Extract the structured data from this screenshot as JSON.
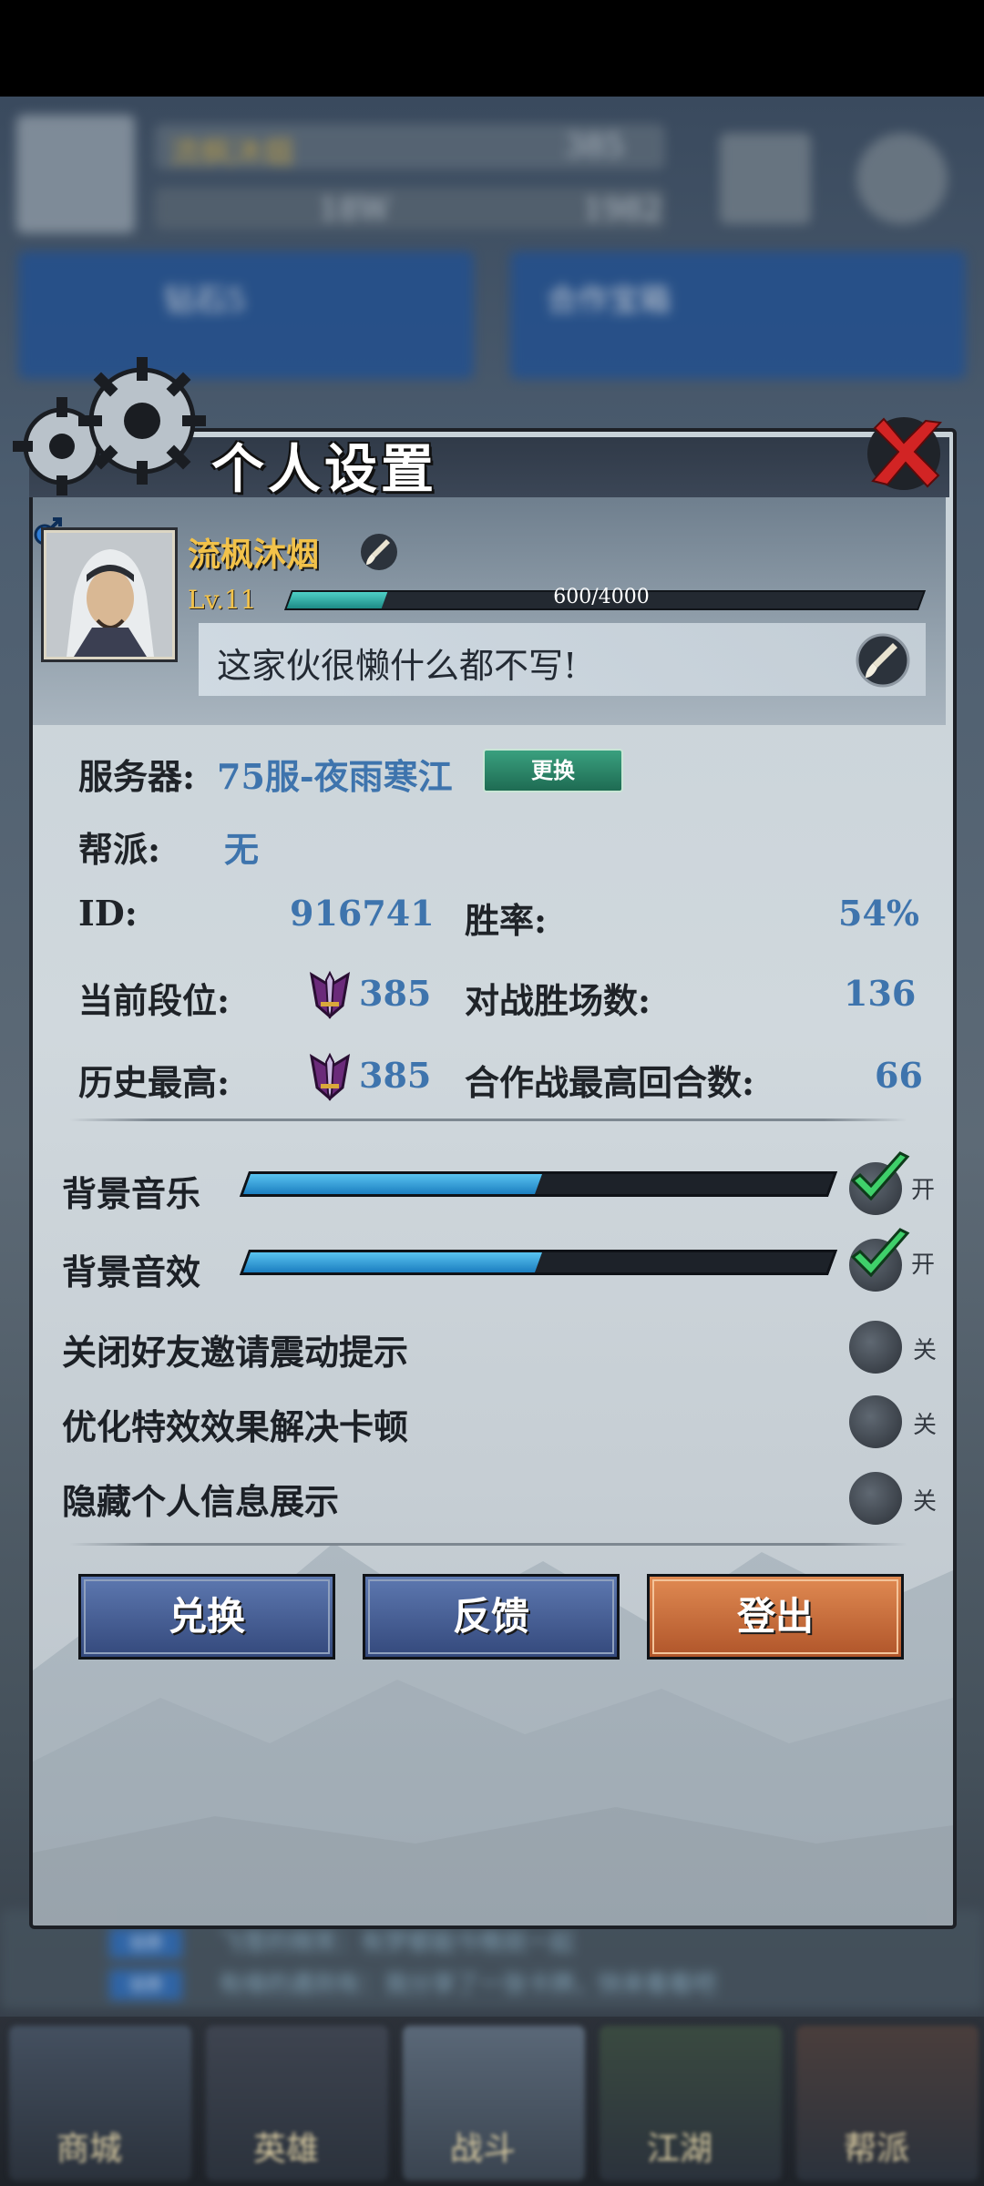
{
  "background": {
    "player_name_blurred": "流枫沐烟",
    "rank_blurred": "385",
    "power_blurred": "18W",
    "gold_blurred": "1982",
    "card1_title": "钻石5",
    "card2_title": "合作宝箱",
    "chat": [
      {
        "tag": "世界",
        "text": "飞雪的微笑：有梦都能今晚就一起"
      },
      {
        "tag": "世界",
        "text": "有缘的遇到有：我分享了一张卡牌，快来看看吧"
      }
    ],
    "nav": [
      "商城",
      "英雄",
      "战斗",
      "江湖",
      "帮派"
    ]
  },
  "dialog": {
    "title": "个人设置",
    "profile": {
      "name": "流枫沐烟",
      "level": "Lv.11",
      "exp_text": "600/4000",
      "exp_fraction": 0.15,
      "signature": "这家伙很懒什么都不写!"
    },
    "info": {
      "server_label": "服务器:",
      "server_value": "75服-夜雨寒江",
      "change_label": "更换",
      "guild_label": "帮派:",
      "guild_value": "无",
      "id_label": "ID:",
      "id_value": "916741",
      "winrate_label": "胜率:",
      "winrate_value": "54%",
      "rank_label": "当前段位:",
      "rank_value": "385",
      "wins_label": "对战胜场数:",
      "wins_value": "136",
      "best_label": "历史最高:",
      "best_value": "385",
      "coop_label": "合作战最高回合数:",
      "coop_value": "66"
    },
    "settings": {
      "music_label": "背景音乐",
      "music_level": 0.5,
      "music_state": "开",
      "sfx_label": "背景音效",
      "sfx_level": 0.5,
      "sfx_state": "开",
      "vibrate_label": "关闭好友邀请震动提示",
      "vibrate_state": "关",
      "effects_label": "优化特效效果解决卡顿",
      "effects_state": "关",
      "hide_label": "隐藏个人信息展示",
      "hide_state": "关"
    },
    "buttons": {
      "redeem": "兑换",
      "feedback": "反馈",
      "logout": "登出"
    }
  }
}
